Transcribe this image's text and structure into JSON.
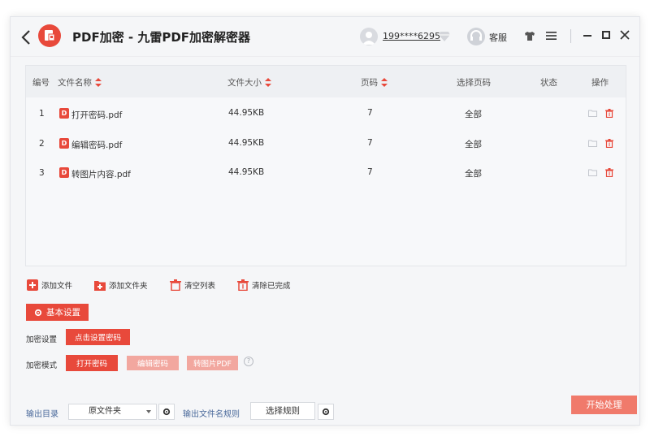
{
  "app": {
    "title": "PDF加密 - 九雷PDF加密解密器",
    "user_name": "199****6295",
    "service_label": "客服",
    "accent": "#e8493b"
  },
  "table": {
    "headers": {
      "index": "编号",
      "name": "文件名称",
      "size": "文件大小",
      "pages": "页码",
      "page_select": "选择页码",
      "status": "状态",
      "actions": "操作"
    },
    "rows": [
      {
        "index": "1",
        "name": "打开密码.pdf",
        "size": "44.95KB",
        "pages": "7",
        "page_select": "全部",
        "status": ""
      },
      {
        "index": "2",
        "name": "编辑密码.pdf",
        "size": "44.95KB",
        "pages": "7",
        "page_select": "全部",
        "status": ""
      },
      {
        "index": "3",
        "name": "转图片内容.pdf",
        "size": "44.95KB",
        "pages": "7",
        "page_select": "全部",
        "status": ""
      }
    ]
  },
  "toolbar": {
    "add_file": "添加文件",
    "add_folder": "添加文件夹",
    "clear_list": "清空列表",
    "clear_done": "清除已完成"
  },
  "settings": {
    "tab_label": "基本设置",
    "encrypt_label": "加密设置",
    "set_password_btn": "点击设置密码",
    "mode_label": "加密模式",
    "modes": [
      "打开密码",
      "编辑密码",
      "转图片PDF"
    ],
    "help": "?"
  },
  "output": {
    "dir_label": "输出目录",
    "dir_value": "原文件夹",
    "rule_label": "输出文件名规则",
    "rule_btn": "选择规则",
    "start_btn": "开始处理"
  }
}
